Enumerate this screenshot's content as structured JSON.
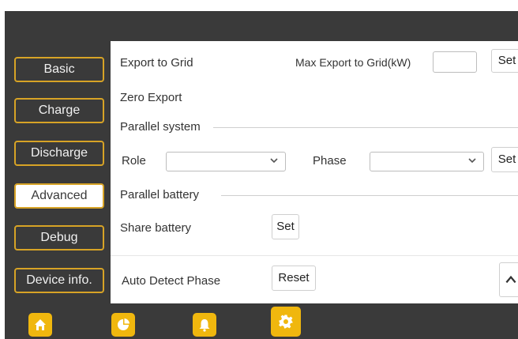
{
  "sidebar": {
    "items": [
      {
        "label": "Basic"
      },
      {
        "label": "Charge"
      },
      {
        "label": "Discharge"
      },
      {
        "label": "Advanced"
      },
      {
        "label": "Debug"
      },
      {
        "label": "Device info."
      }
    ],
    "active": "Advanced"
  },
  "main": {
    "export_to_grid_label": "Export to Grid",
    "max_export_label": "Max Export to Grid(kW)",
    "max_export_value": "",
    "set_label": "Set",
    "zero_export_label": "Zero Export",
    "parallel_system_label": "Parallel system",
    "role_label": "Role",
    "role_value": "",
    "phase_label": "Phase",
    "phase_value": "",
    "parallel_battery_label": "Parallel battery",
    "share_battery_label": "Share battery",
    "auto_detect_label": "Auto Detect Phase",
    "reset_label": "Reset"
  },
  "bottom_nav": {
    "icons": [
      "home-icon",
      "pie-chart-icon",
      "bell-icon",
      "gear-icon"
    ],
    "accent_color": "#f0b70e"
  },
  "colors": {
    "sidebar_bg": "#3a3a3a",
    "button_border": "#d7a326"
  }
}
